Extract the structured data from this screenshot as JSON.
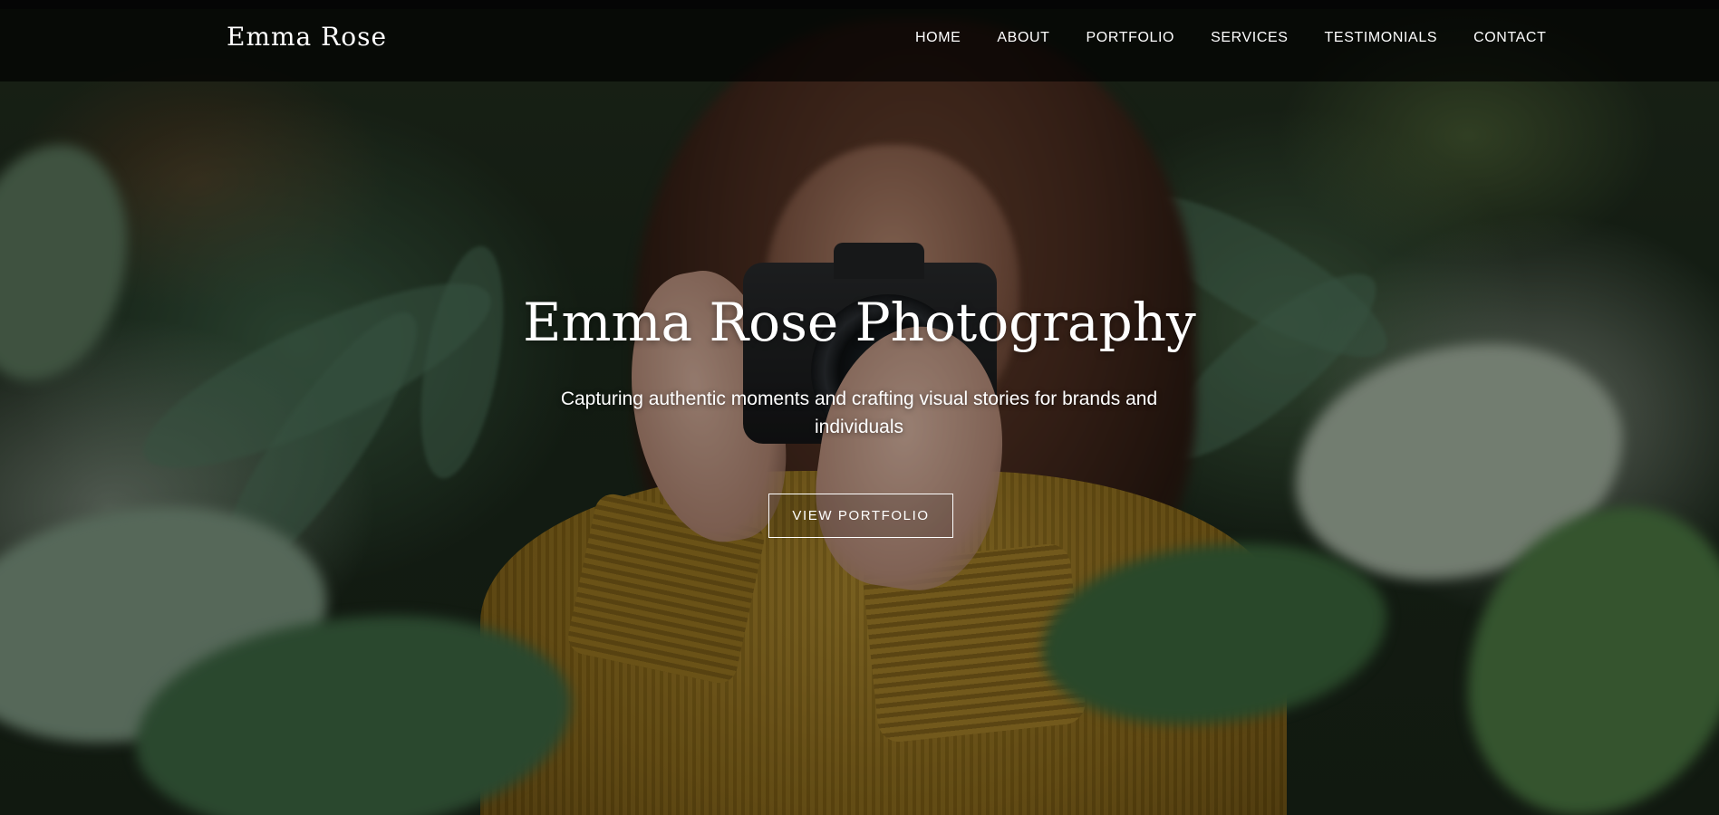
{
  "brand": {
    "name": "Emma Rose"
  },
  "nav": {
    "items": [
      {
        "label": "HOME"
      },
      {
        "label": "ABOUT"
      },
      {
        "label": "PORTFOLIO"
      },
      {
        "label": "SERVICES"
      },
      {
        "label": "TESTIMONIALS"
      },
      {
        "label": "CONTACT"
      }
    ]
  },
  "hero": {
    "title": "Emma Rose Photography",
    "subtitle": "Capturing authentic moments and crafting visual stories for brands and individuals",
    "cta_label": "VIEW PORTFOLIO",
    "background_icon": "hero-photo-woman-with-camera-in-ferns"
  },
  "colors": {
    "text": "#ffffff",
    "nav_background": "#000000",
    "sweater": "#a8842a",
    "foliage": "#2f4a34"
  }
}
